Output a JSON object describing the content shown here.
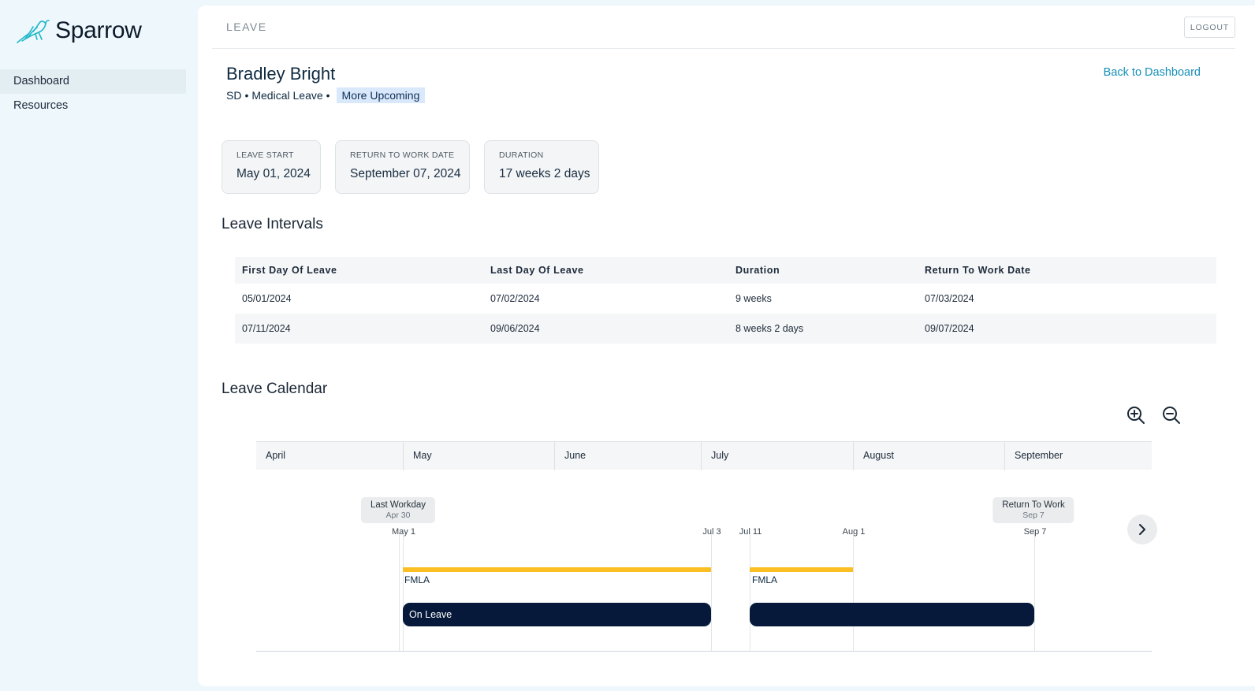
{
  "sidebar": {
    "brand": "Sparrow",
    "items": [
      {
        "label": "Dashboard"
      },
      {
        "label": "Resources"
      }
    ]
  },
  "header": {
    "title": "LEAVE",
    "logout_label": "LOGOUT"
  },
  "employee": {
    "name": "Bradley Bright",
    "state": "SD",
    "leave_type": "Medical Leave",
    "tag": "More Upcoming"
  },
  "back_link": "Back to Dashboard",
  "stats": [
    {
      "label": "LEAVE START",
      "value": "May 01, 2024"
    },
    {
      "label": "RETURN TO WORK DATE",
      "value": "September 07, 2024"
    },
    {
      "label": "DURATION",
      "value": "17 weeks 2 days"
    }
  ],
  "intervals": {
    "title": "Leave Intervals",
    "columns": [
      "First Day Of Leave",
      "Last Day Of Leave",
      "Duration",
      "Return To Work Date"
    ],
    "rows": [
      [
        "05/01/2024",
        "07/02/2024",
        "9 weeks",
        "07/03/2024"
      ],
      [
        "07/11/2024",
        "09/06/2024",
        "8 weeks 2 days",
        "09/07/2024"
      ]
    ]
  },
  "calendar": {
    "title": "Leave Calendar",
    "months": [
      "April",
      "May",
      "June",
      "July",
      "August",
      "September"
    ],
    "markers": [
      {
        "title": "Last Workday",
        "date": "Apr 30"
      },
      {
        "title": "Return To Work",
        "date": "Sep 7"
      }
    ],
    "ticks": [
      "May 1",
      "Jul 3",
      "Jul 11",
      "Aug 1",
      "Sep 7"
    ],
    "fmla_label": "FMLA",
    "leave_label": "On Leave",
    "colors": {
      "fmla": "#fbbf24",
      "on_leave": "#06193a"
    }
  },
  "icons": {
    "zoom_in": "zoom-in-icon",
    "zoom_out": "zoom-out-icon",
    "next": "chevron-right-icon",
    "brand": "sparrow-bird-icon"
  }
}
